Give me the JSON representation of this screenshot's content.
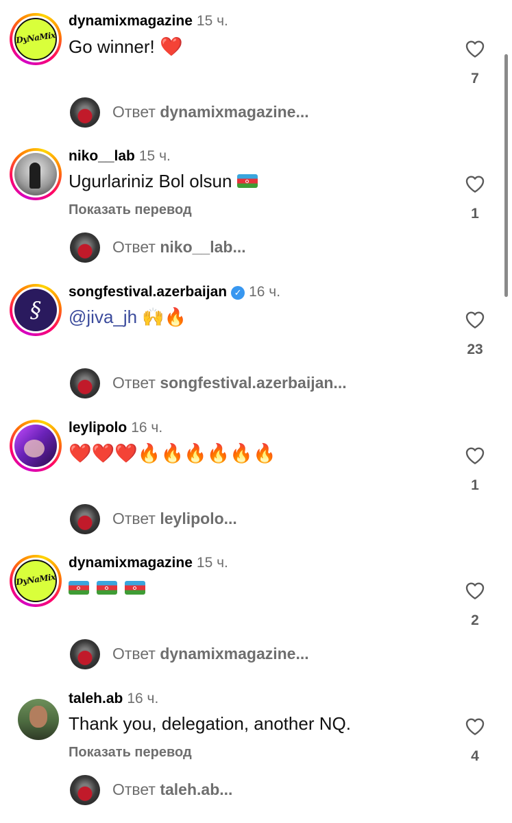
{
  "comments": [
    {
      "username": "dynamixmagazine",
      "time": "15 ч.",
      "verified": false,
      "text": "Go winner!",
      "emojis": "❤️",
      "show_translation": false,
      "likes": "7",
      "reply": {
        "label": "Ответ",
        "target": "dynamixmagazine..."
      },
      "avatar": {
        "kind": "dynamix",
        "text": "DyNaMix",
        "ring": true
      }
    },
    {
      "username": "niko__lab",
      "time": "15 ч.",
      "verified": false,
      "text": "Ugurlariniz Bol olsun",
      "emojis": "🇦🇿",
      "show_translation": true,
      "translation_label": "Показать перевод",
      "likes": "1",
      "reply": {
        "label": "Ответ",
        "target": "niko__lab..."
      },
      "avatar": {
        "kind": "photo",
        "ring": true
      }
    },
    {
      "username": "songfestival.azerbaijan",
      "time": "16 ч.",
      "verified": true,
      "text": "@jiva_jh",
      "emojis": "🙌🔥",
      "show_translation": false,
      "likes": "23",
      "reply": {
        "label": "Ответ",
        "target": "songfestival.azerbaijan..."
      },
      "avatar": {
        "kind": "logo",
        "ring": true
      }
    },
    {
      "username": "leylipolo",
      "time": "16 ч.",
      "verified": false,
      "text": "",
      "emojis": "❤️❤️❤️🔥🔥🔥🔥🔥🔥",
      "show_translation": false,
      "likes": "1",
      "reply": {
        "label": "Ответ",
        "target": "leylipolo..."
      },
      "avatar": {
        "kind": "photo",
        "ring": true
      }
    },
    {
      "username": "dynamixmagazine",
      "time": "15 ч.",
      "verified": false,
      "text": "",
      "emojis": "🇦🇿🇦🇿🇦🇿",
      "show_translation": false,
      "likes": "2",
      "reply": {
        "label": "Ответ",
        "target": "dynamixmagazine..."
      },
      "avatar": {
        "kind": "dynamix",
        "text": "DyNaMix",
        "ring": true
      }
    },
    {
      "username": "taleh.ab",
      "time": "16 ч.",
      "verified": false,
      "text": "Thank you, delegation, another NQ.",
      "emojis": "",
      "show_translation": true,
      "translation_label": "Показать перевод",
      "likes": "4",
      "reply": {
        "label": "Ответ",
        "target": "taleh.ab..."
      },
      "avatar": {
        "kind": "photo",
        "ring": false
      }
    }
  ],
  "colors": {
    "meta_text": "#6e6e6e",
    "mention": "#3b4b9c",
    "verified_badge": "#3897f0",
    "story_ring": [
      "#d300c5",
      "#ff0069",
      "#ff7a00",
      "#ffd600"
    ]
  },
  "icons": [
    "heart-outline-icon",
    "verified-badge-icon"
  ]
}
